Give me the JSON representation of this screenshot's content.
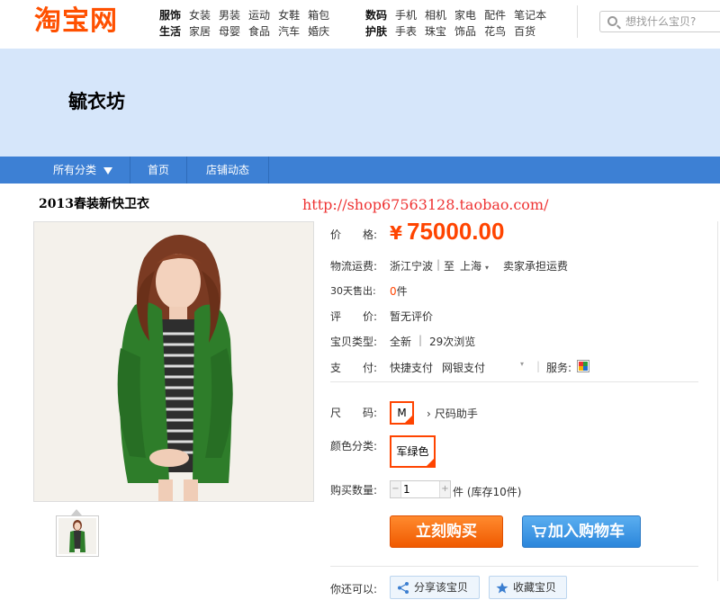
{
  "header": {
    "logo": "淘宝网",
    "categories": [
      {
        "row1": [
          "服饰",
          "女装",
          "男装",
          "运动",
          "女鞋",
          "箱包"
        ],
        "row2": [
          "生活",
          "家居",
          "母婴",
          "食品",
          "汽车",
          "婚庆"
        ]
      },
      {
        "row1": [
          "数码",
          "手机",
          "相机",
          "家电",
          "配件",
          "笔记本"
        ],
        "row2": [
          "护肤",
          "手表",
          "珠宝",
          "饰品",
          "花鸟",
          "百货"
        ]
      }
    ],
    "search_placeholder": "想找什么宝贝?"
  },
  "banner": {
    "shop_name": "毓衣坊"
  },
  "nav": {
    "all": "所有分类",
    "home": "首页",
    "news": "店铺动态"
  },
  "item": {
    "title": "2013春装新快卫衣",
    "watermark": "http://shop67563128.taobao.com/",
    "price_label": "价　　格:",
    "currency": "¥",
    "price": "75000.00",
    "shipping_label": "物流运费:",
    "shipping_from": "浙江宁波",
    "shipping_to_prefix": "至",
    "shipping_to": "上海",
    "shipping_note": "卖家承担运费",
    "sold_label": "30天售出:",
    "sold_count": "0",
    "sold_unit": "件",
    "rating_label": "评　　价:",
    "rating_value": "暂无评价",
    "type_label": "宝贝类型:",
    "type_value": "全新",
    "views": "29次浏览",
    "pay_label": "支　　付:",
    "pay_quick": "快捷支付",
    "pay_bank": "网银支付",
    "service_label": "服务:",
    "size_label": "尺　　码:",
    "size_value": "M",
    "size_helper": "尺码助手",
    "color_label": "颜色分类:",
    "color_value": "军绿色",
    "qty_label": "购买数量:",
    "qty_value": "1",
    "qty_unit": "件 (库存10件)",
    "buy_button": "立刻购买",
    "cart_button": "加入购物车",
    "more_label": "你还可以:",
    "share_button": "分享该宝贝",
    "fav_button": "收藏宝贝"
  },
  "colors": {
    "taobao_orange": "#ff5000",
    "nav_blue": "#3d80d4",
    "banner_bg": "#d6e6fa",
    "cart_blue": "#2b86db"
  }
}
